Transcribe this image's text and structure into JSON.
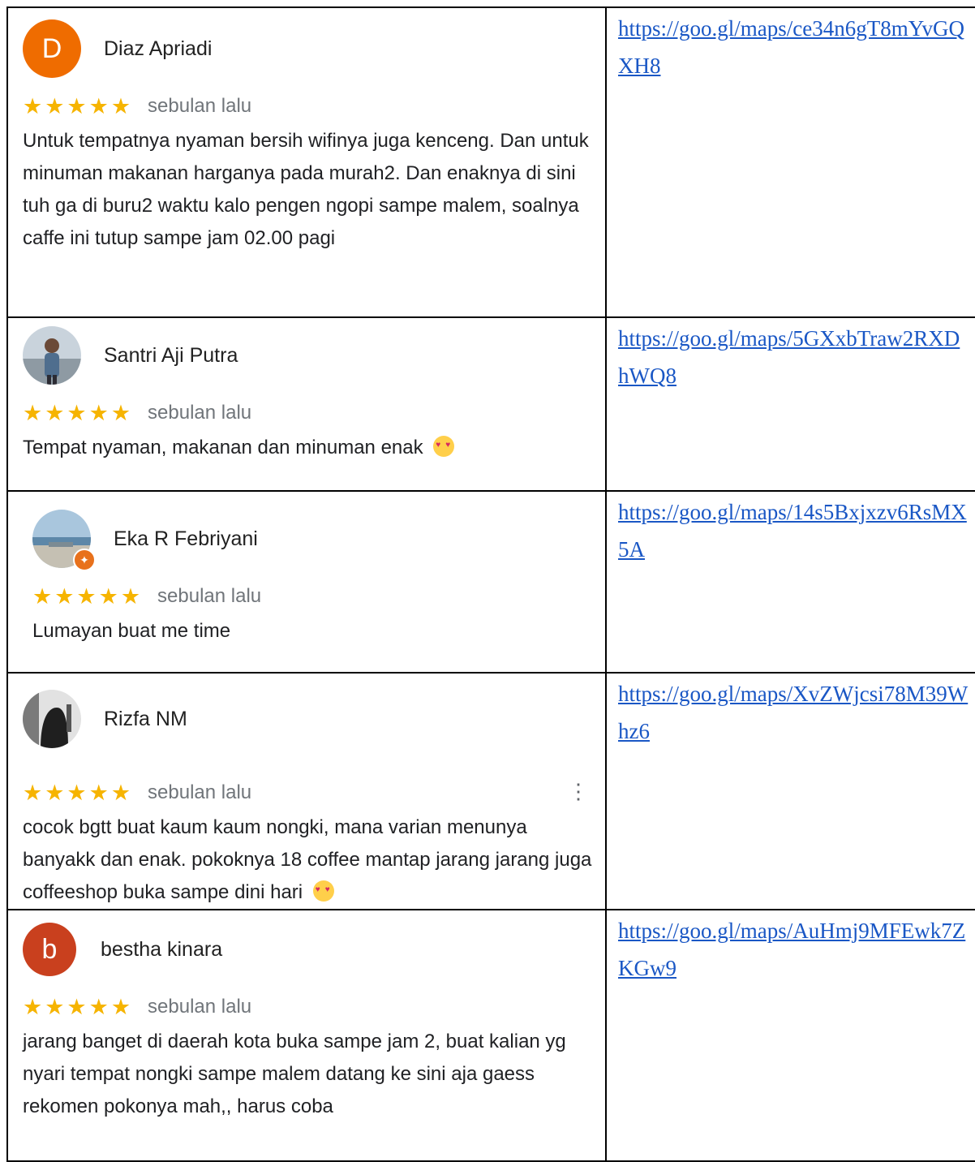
{
  "reviews": [
    {
      "name": "Diaz Apriadi",
      "avatar_letter": "D",
      "avatar_color": "#ef6c00",
      "stars": "★★★★★",
      "time": "sebulan lalu",
      "text": "Untuk tempatnya nyaman bersih wifinya juga kenceng. Dan untuk minuman makanan harganya pada murah2. Dan enaknya di sini tuh ga di buru2 waktu kalo pengen ngopi sampe malem, soalnya caffe ini tutup sampe jam 02.00 pagi",
      "link": "https://goo.gl/maps/ce34n6gT8mYvGQXH8"
    },
    {
      "name": "Santri Aji Putra",
      "avatar_icon": "person-photo-icon",
      "stars": "★★★★★",
      "time": "sebulan lalu",
      "text": "Tempat nyaman, makanan dan minuman enak",
      "emoji": "smiling-face-with-hearts-icon",
      "link": "https://goo.gl/maps/5GXxbTraw2RXDhWQ8"
    },
    {
      "name": "Eka R Febriyani",
      "avatar_icon": "beach-photo-icon",
      "badge_icon": "local-guide-icon",
      "stars": "★★★★★",
      "time": "sebulan lalu",
      "text": "Lumayan buat me time",
      "link": "https://goo.gl/maps/14s5Bxjxzv6RsMX5A"
    },
    {
      "name": "Rizfa NM",
      "avatar_icon": "bw-photo-icon",
      "stars": "★★★★★",
      "time": "sebulan lalu",
      "menu": "⋮",
      "text": "cocok bgtt buat kaum kaum nongki, mana varian menunya banyakk dan enak. pokoknya 18 coffee mantap jarang jarang juga coffeeshop buka sampe dini hari",
      "emoji": "heart-eyes-icon",
      "link": "https://goo.gl/maps/XvZWjcsi78M39Whz6"
    },
    {
      "name": "bestha kinara",
      "avatar_letter": "b",
      "avatar_color": "#c9401e",
      "stars": "★★★★★",
      "time": "sebulan lalu",
      "text": "jarang banget di daerah kota buka sampe jam 2, buat kalian yg nyari tempat nongki sampe malem datang ke sini aja gaess rekomen pokonya mah,, harus coba",
      "link": "https://goo.gl/maps/AuHmj9MFEwk7ZKGw9"
    }
  ]
}
